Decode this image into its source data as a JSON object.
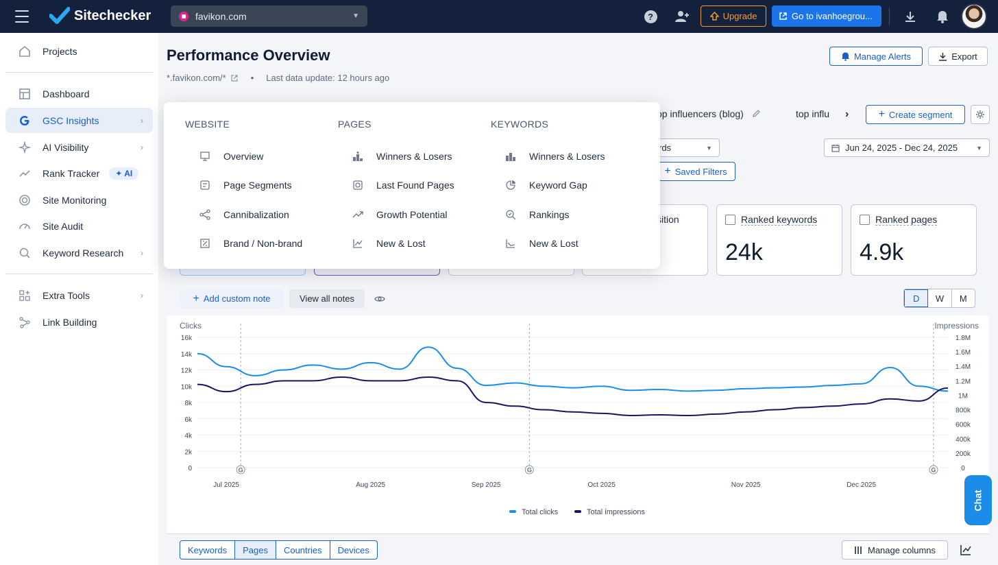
{
  "app": {
    "name": "Sitechecker"
  },
  "topbar": {
    "site": "favikon.com",
    "upgrade_label": "Upgrade",
    "goto_label": "Go to ivanhoegrou..."
  },
  "sidebar": {
    "items": [
      {
        "label": "Projects"
      },
      {
        "label": "Dashboard"
      },
      {
        "label": "GSC Insights"
      },
      {
        "label": "AI Visibility"
      },
      {
        "label": "Rank Tracker",
        "badge": "AI"
      },
      {
        "label": "Site Monitoring"
      },
      {
        "label": "Site Audit"
      },
      {
        "label": "Keyword Research"
      },
      {
        "label": "Extra Tools"
      },
      {
        "label": "Link Building"
      }
    ]
  },
  "header": {
    "title": "Performance Overview",
    "domain": "*.favikon.com/*",
    "separator": "•",
    "last_update": "Last data update: 12 hours ago",
    "manage_alerts": "Manage Alerts",
    "export": "Export"
  },
  "segments": {
    "seg1": "op influencers (blog)",
    "seg2": "top influ",
    "create": "Create segment"
  },
  "filters": {
    "select_value": "rds",
    "saved_filters": "Saved Filters",
    "date_range": "Jun 24, 2025 - Dec 24, 2025"
  },
  "kpis": {
    "partial_label": "sition",
    "ranked_keywords": {
      "label": "Ranked keywords",
      "value": "24k"
    },
    "ranked_pages": {
      "label": "Ranked pages",
      "value": "4.9k"
    }
  },
  "notes": {
    "add": "Add custom note",
    "view_all": "View all notes"
  },
  "granularity": {
    "d": "D",
    "w": "W",
    "m": "M",
    "selected": "D"
  },
  "menu": {
    "website": {
      "heading": "WEBSITE",
      "items": [
        "Overview",
        "Page Segments",
        "Cannibalization",
        "Brand / Non-brand"
      ]
    },
    "pages": {
      "heading": "PAGES",
      "items": [
        "Winners & Losers",
        "Last Found Pages",
        "Growth Potential",
        "New & Lost"
      ]
    },
    "keywords": {
      "heading": "KEYWORDS",
      "items": [
        "Winners & Losers",
        "Keyword Gap",
        "Rankings",
        "New & Lost"
      ]
    }
  },
  "bottom_tabs": [
    "Keywords",
    "Pages",
    "Countries",
    "Devices"
  ],
  "bottom_selected": "Pages",
  "manage_columns": "Manage columns",
  "chat_label": "Chat",
  "colors": {
    "clicks": "#1c8ce9",
    "impressions": "#1a1464",
    "accent": "#1c5fc8",
    "topbar": "#14213d"
  },
  "chart_data": {
    "type": "line",
    "y_left": {
      "title": "Clicks",
      "ticks": [
        "16k",
        "14k",
        "12k",
        "10k",
        "8k",
        "6k",
        "4k",
        "2k",
        "0"
      ],
      "range": [
        0,
        16000
      ]
    },
    "y_right": {
      "title": "Impressions",
      "ticks": [
        "1.8M",
        "1.6M",
        "1.4M",
        "1.2M",
        "1M",
        "800k",
        "600k",
        "400k",
        "200k",
        "0"
      ],
      "range": [
        0,
        1800000
      ]
    },
    "x_ticks": [
      "Jul 2025",
      "Aug 2025",
      "Sep 2025",
      "Oct 2025",
      "Nov 2025",
      "Dec 2025"
    ],
    "annotation_marker": "G",
    "legend": [
      "Total clicks",
      "Total impressions"
    ],
    "x": [
      "Jun 24",
      "Jul 1",
      "Jul 8",
      "Jul 15",
      "Jul 22",
      "Jul 29",
      "Aug 5",
      "Aug 12",
      "Aug 19",
      "Aug 26",
      "Sep 2",
      "Sep 9",
      "Sep 16",
      "Sep 23",
      "Sep 30",
      "Oct 7",
      "Oct 14",
      "Oct 21",
      "Oct 28",
      "Nov 4",
      "Nov 11",
      "Nov 18",
      "Nov 25",
      "Dec 2",
      "Dec 9",
      "Dec 16",
      "Dec 24"
    ],
    "series": [
      {
        "name": "Total clicks",
        "axis": "left",
        "values": [
          14000,
          12400,
          11300,
          12000,
          12600,
          12100,
          12900,
          12100,
          14800,
          12200,
          10100,
          10400,
          10000,
          9800,
          10000,
          9500,
          9600,
          9400,
          9500,
          9700,
          9800,
          9900,
          10100,
          10300,
          12300,
          10000,
          9400
        ]
      },
      {
        "name": "Total impressions",
        "axis": "right",
        "values": [
          1150000,
          1050000,
          1150000,
          1200000,
          1200000,
          1250000,
          1200000,
          1200000,
          1250000,
          1200000,
          900000,
          850000,
          800000,
          770000,
          750000,
          720000,
          730000,
          720000,
          740000,
          770000,
          800000,
          830000,
          850000,
          880000,
          950000,
          920000,
          1100000
        ]
      }
    ]
  }
}
